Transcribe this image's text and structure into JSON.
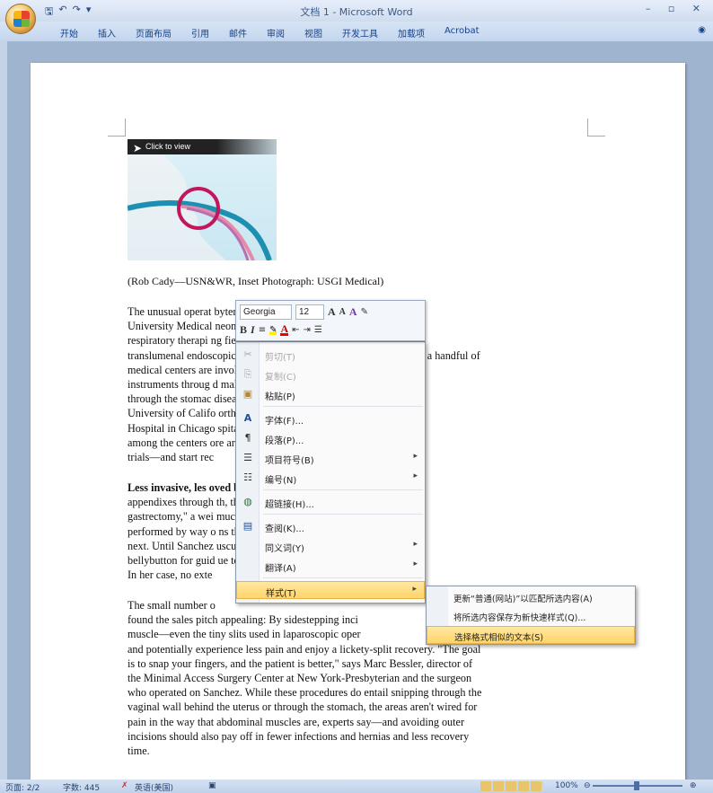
{
  "window": {
    "title": "文档 1 - Microsoft Word",
    "controls": "– ▫ ✕",
    "qat_icons": [
      "save-icon",
      "undo-icon",
      "redo-icon"
    ]
  },
  "ribbon": {
    "tabs": [
      "开始",
      "插入",
      "页面布局",
      "引用",
      "邮件",
      "审阅",
      "视图",
      "开发工具",
      "加载项",
      "Acrobat"
    ]
  },
  "figure": {
    "overlay_label": "Click to view"
  },
  "document": {
    "caption": "(Rob Cady—USN&WR, Inset Photograph: USGI Medical)",
    "paragraph1": [
      "The unusual operat                                       byterian Hospital/Columbia",
      "University Medical                                       neonatal pediatric",
      "respiratory therapi                                        ng field of \"natural orifice",
      "translumenal endoscopic surgery,\" or NOTES for short. Surgeons at a handful of",
      "medical centers are                           involves snaking flexible",
      "instruments throug                           d making internal incisions—",
      "through the stomac                           diseased organs. The",
      "University of Califo                           orthwestern Memorial",
      "Hospital in Chicago                           spital in Portland, Ore., are",
      "among the centers                            ore are expected to begin",
      "trials—and start rec"
    ],
    "paragraph2": [
      "Less invasive, les                                      oved both gallbladders and",
      "appendixes through                                  th, the first \"sleeve",
      "gastrectomy,\" a wei                                 much of the stomach, was",
      "performed by way o                                  ns through the anus may be",
      "next. Until Sanchez                                 uscule camera through the",
      "bellybutton for guid                                ue to do so for added safety.",
      "In her case, no exte"
    ],
    "paragraph3": [
      "The small number o                                      ",
      "found the sales pitch appealing: By sidestepping inci",
      "muscle—even the tiny slits used in laparoscopic oper",
      "and potentially experience less pain and enjoy a lickety-split recovery. \"The goal",
      "is to snap your fingers, and the patient is better,\" says Marc Bessler, director of",
      "the Minimal Access Surgery Center at New York-Presbyterian and the surgeon",
      "who operated on Sanchez. While these procedures do entail snipping through the",
      "vaginal wall behind the uterus or through the stomach, the areas aren't wired for",
      "pain in the way that abdominal muscles are, experts say—and avoiding outer",
      "incisions should also pay off in fewer infections and hernias and less recovery",
      "time."
    ]
  },
  "mini_toolbar": {
    "font_name": "Georgia",
    "font_size": "12",
    "grow": "A",
    "shrink": "A",
    "bold": "B",
    "italic": "I"
  },
  "context_menu": {
    "items": [
      {
        "label": "剪切(T)",
        "icon": "cut-icon",
        "glyph": "✂",
        "disabled": true
      },
      {
        "label": "复制(C)",
        "icon": "copy-icon",
        "glyph": "⎘",
        "disabled": true
      },
      {
        "label": "粘贴(P)",
        "icon": "paste-icon",
        "glyph": "📋",
        "disabled": false
      },
      {
        "label": "字体(F)...",
        "icon": "font-icon",
        "glyph": "A",
        "disabled": false
      },
      {
        "label": "段落(P)...",
        "icon": "paragraph-icon",
        "glyph": "¶",
        "disabled": false
      },
      {
        "label": "项目符号(B)",
        "icon": "bullets-icon",
        "glyph": "☰",
        "disabled": false,
        "submenu": true
      },
      {
        "label": "编号(N)",
        "icon": "numbering-icon",
        "glyph": "☷",
        "disabled": false,
        "submenu": true
      },
      {
        "label": "超链接(H)...",
        "icon": "hyperlink-icon",
        "glyph": "🌐",
        "disabled": false
      },
      {
        "label": "查阅(K)...",
        "icon": "lookup-icon",
        "glyph": "📖",
        "disabled": false
      },
      {
        "label": "同义词(Y)",
        "icon": "",
        "glyph": "",
        "disabled": false,
        "submenu": true
      },
      {
        "label": "翻译(A)",
        "icon": "",
        "glyph": "",
        "disabled": false,
        "submenu": true
      },
      {
        "label": "样式(T)",
        "icon": "",
        "glyph": "",
        "disabled": false,
        "submenu": true,
        "active": true
      }
    ]
  },
  "styles_submenu": {
    "items": [
      {
        "label": "更新“普通(网站)”以匹配所选内容(A)",
        "active": false
      },
      {
        "label": "将所选内容保存为新快速样式(Q)...",
        "active": false
      },
      {
        "label": "选择格式相似的文本(S)",
        "active": true
      }
    ]
  },
  "statusbar": {
    "page": "页面: 2/2",
    "words": "字数: 445",
    "language": "英语(美国)",
    "zoom": "100%"
  }
}
